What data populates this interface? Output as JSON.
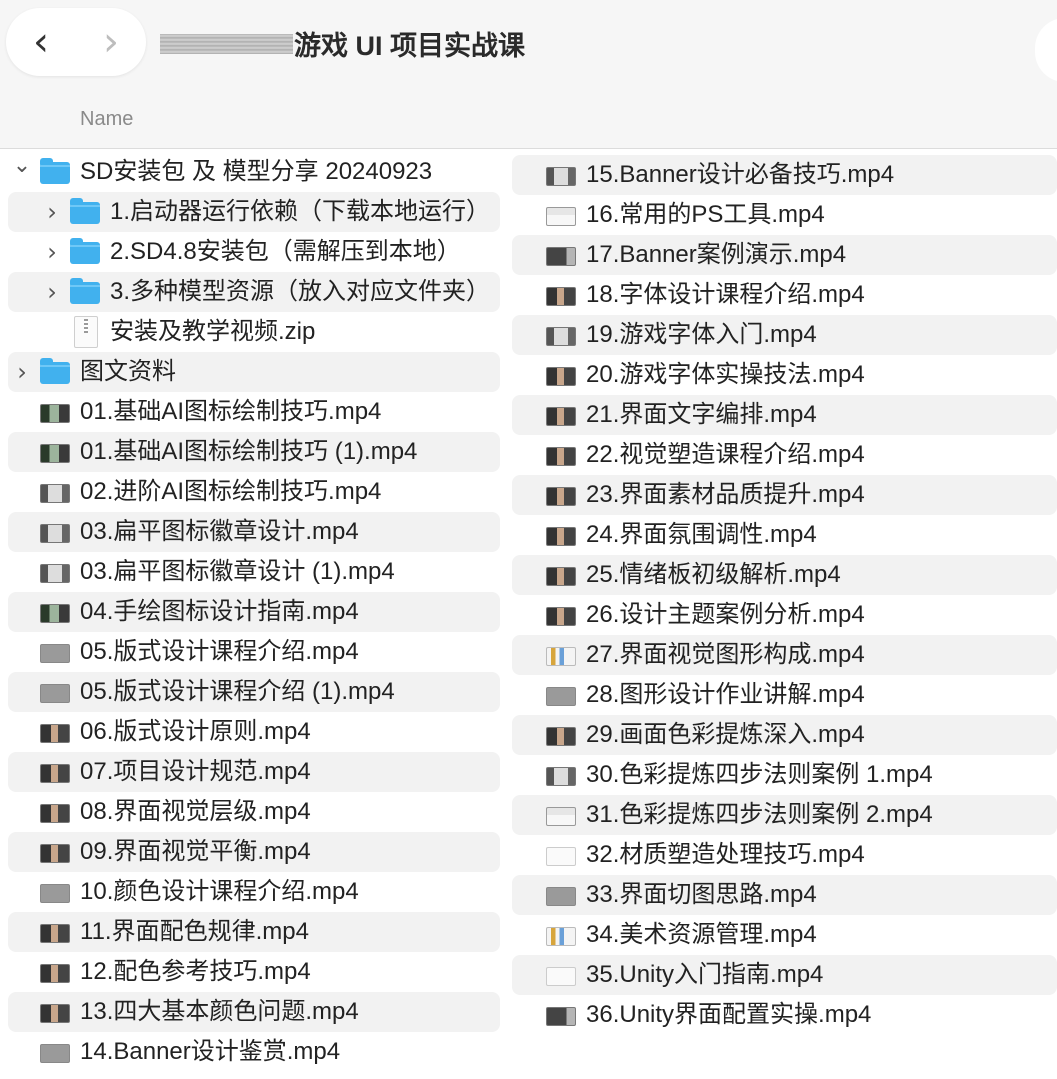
{
  "window": {
    "title": "游戏 UI 项目实战课"
  },
  "nav": {
    "back_glyph": "‹",
    "forward_glyph": "›"
  },
  "column_header": {
    "name": "Name"
  },
  "left_column": [
    {
      "label": "SD安装包 及 模型分享 20240923",
      "kind": "folder",
      "expanded": true,
      "indent": 0
    },
    {
      "label": "1.启动器运行依赖（下载本地运行）",
      "kind": "folder",
      "expanded": false,
      "indent": 1
    },
    {
      "label": "2.SD4.8安装包（需解压到本地）",
      "kind": "folder",
      "expanded": false,
      "indent": 1
    },
    {
      "label": "3.多种模型资源（放入对应文件夹）",
      "kind": "folder",
      "expanded": false,
      "indent": 1
    },
    {
      "label": "安装及教学视频.zip",
      "kind": "zip",
      "indent": 1
    },
    {
      "label": "图文资料",
      "kind": "folder",
      "expanded": false,
      "indent": 0
    },
    {
      "label": "01.基础AI图标绘制技巧.mp4",
      "kind": "video",
      "thumb": "mid",
      "indent": 0
    },
    {
      "label": "01.基础AI图标绘制技巧 (1).mp4",
      "kind": "video",
      "thumb": "mid",
      "indent": 0
    },
    {
      "label": "02.进阶AI图标绘制技巧.mp4",
      "kind": "video",
      "thumb": "light",
      "indent": 0
    },
    {
      "label": "03.扁平图标徽章设计.mp4",
      "kind": "video",
      "thumb": "light",
      "indent": 0
    },
    {
      "label": "03.扁平图标徽章设计 (1).mp4",
      "kind": "video",
      "thumb": "light",
      "indent": 0
    },
    {
      "label": "04.手绘图标设计指南.mp4",
      "kind": "video",
      "thumb": "mid",
      "indent": 0
    },
    {
      "label": "05.版式设计课程介绍.mp4",
      "kind": "video",
      "thumb": "gray",
      "indent": 0
    },
    {
      "label": "05.版式设计课程介绍 (1).mp4",
      "kind": "video",
      "thumb": "gray",
      "indent": 0
    },
    {
      "label": "06.版式设计原则.mp4",
      "kind": "video",
      "thumb": "dark",
      "indent": 0
    },
    {
      "label": "07.项目设计规范.mp4",
      "kind": "video",
      "thumb": "dark",
      "indent": 0
    },
    {
      "label": "08.界面视觉层级.mp4",
      "kind": "video",
      "thumb": "dark",
      "indent": 0
    },
    {
      "label": "09.界面视觉平衡.mp4",
      "kind": "video",
      "thumb": "dark",
      "indent": 0
    },
    {
      "label": "10.颜色设计课程介绍.mp4",
      "kind": "video",
      "thumb": "gray",
      "indent": 0
    },
    {
      "label": "11.界面配色规律.mp4",
      "kind": "video",
      "thumb": "dark",
      "indent": 0
    },
    {
      "label": "12.配色参考技巧.mp4",
      "kind": "video",
      "thumb": "dark",
      "indent": 0
    },
    {
      "label": "13.四大基本颜色问题.mp4",
      "kind": "video",
      "thumb": "dark",
      "indent": 0
    },
    {
      "label": "14.Banner设计鉴赏.mp4",
      "kind": "video",
      "thumb": "gray",
      "indent": 0
    }
  ],
  "right_column": [
    {
      "label": "15.Banner设计必备技巧.mp4",
      "thumb": "light"
    },
    {
      "label": "16.常用的PS工具.mp4",
      "thumb": "doc"
    },
    {
      "label": "17.Banner案例演示.mp4",
      "thumb": "slate"
    },
    {
      "label": "18.字体设计课程介绍.mp4",
      "thumb": "dark"
    },
    {
      "label": "19.游戏字体入门.mp4",
      "thumb": "light"
    },
    {
      "label": "20.游戏字体实操技法.mp4",
      "thumb": "dark"
    },
    {
      "label": "21.界面文字编排.mp4",
      "thumb": "dark"
    },
    {
      "label": "22.视觉塑造课程介绍.mp4",
      "thumb": "dark"
    },
    {
      "label": "23.界面素材品质提升.mp4",
      "thumb": "dark"
    },
    {
      "label": "24.界面氛围调性.mp4",
      "thumb": "dark"
    },
    {
      "label": "25.情绪板初级解析.mp4",
      "thumb": "dark"
    },
    {
      "label": "26.设计主题案例分析.mp4",
      "thumb": "dark"
    },
    {
      "label": "27.界面视觉图形构成.mp4",
      "thumb": "chart"
    },
    {
      "label": "28.图形设计作业讲解.mp4",
      "thumb": "gray"
    },
    {
      "label": "29.画面色彩提炼深入.mp4",
      "thumb": "dark"
    },
    {
      "label": "30.色彩提炼四步法则案例 1.mp4",
      "thumb": "light"
    },
    {
      "label": "31.色彩提炼四步法则案例 2.mp4",
      "thumb": "doc"
    },
    {
      "label": "32.材质塑造处理技巧.mp4",
      "thumb": "white"
    },
    {
      "label": "33.界面切图思路.mp4",
      "thumb": "gray"
    },
    {
      "label": "34.美术资源管理.mp4",
      "thumb": "chart"
    },
    {
      "label": "35.Unity入门指南.mp4",
      "thumb": "white"
    },
    {
      "label": "36.Unity界面配置实操.mp4",
      "thumb": "slate"
    }
  ]
}
